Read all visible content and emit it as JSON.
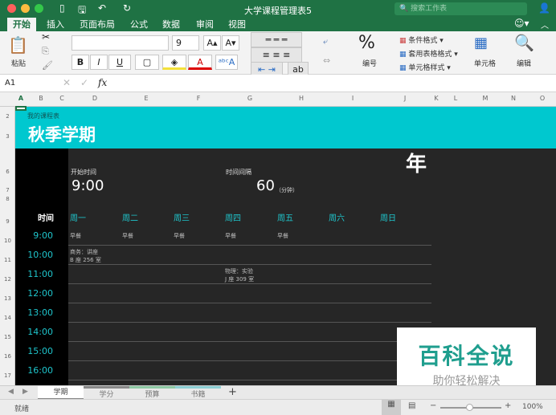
{
  "window": {
    "title": "大学课程管理表5",
    "search_placeholder": "搜索工作表"
  },
  "ribbon_tabs": [
    "开始",
    "插入",
    "页面布局",
    "公式",
    "数据",
    "审阅",
    "视图"
  ],
  "ribbon": {
    "paste": "粘贴",
    "font_size": "9",
    "font_name": "",
    "bold": "B",
    "italic": "I",
    "underline": "U",
    "number_label": "编号",
    "percent": "%",
    "conditional": "条件格式",
    "table_format": "套用表格格式",
    "cell_style": "单元格样式",
    "cells": "单元格",
    "edit": "编辑"
  },
  "formula_bar": {
    "cell_ref": "A1",
    "fx": "fx",
    "value": ""
  },
  "columns": [
    "A",
    "B",
    "C",
    "D",
    "E",
    "F",
    "G",
    "H",
    "I",
    "J",
    "K",
    "L",
    "M",
    "N",
    "O"
  ],
  "rows": [
    "2",
    "3",
    "6",
    "7",
    "8",
    "9",
    "10",
    "11",
    "12",
    "13",
    "14",
    "15",
    "16",
    "17"
  ],
  "sheet": {
    "subtitle": "我的课程表",
    "title": "秋季学期",
    "year": "年",
    "start_label": "开始时间",
    "start_value": "9:00",
    "interval_label": "时间间隔",
    "interval_value": "60",
    "interval_unit": "（分钟）",
    "time_header": "时间",
    "days": [
      "周一",
      "周二",
      "周三",
      "周四",
      "周五",
      "周六",
      "周日"
    ],
    "times": [
      "9:00",
      "10:00",
      "11:00",
      "12:00",
      "13:00",
      "14:00",
      "15:00",
      "16:00"
    ],
    "breakfast": "早餐",
    "entries": [
      {
        "line1": "商务：讲座",
        "line2": "B 座 256 室"
      },
      {
        "line1": "物理：实验",
        "line2": "J 座 309 室"
      }
    ]
  },
  "sheet_tabs": [
    "学期",
    "学分",
    "预算",
    "书籍"
  ],
  "add_sheet": "+",
  "status": {
    "ready": "就绪",
    "zoom": "100%"
  },
  "watermark": {
    "line1": "百科全说",
    "line2": "助你轻松解决"
  }
}
